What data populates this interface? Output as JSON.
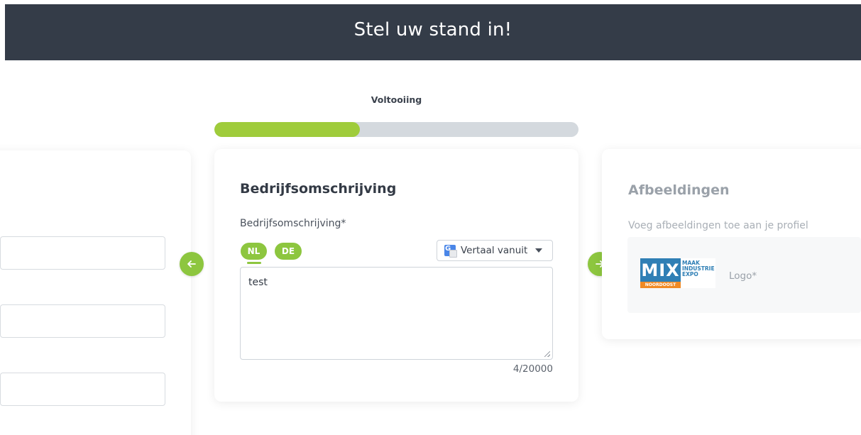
{
  "header": {
    "title": "Stel uw stand in!"
  },
  "progress": {
    "label": "Voltooiing",
    "fraction": 0.4
  },
  "description_card": {
    "title": "Bedrijfsomschrijving",
    "field_label": "Bedrijfsomschrijving*",
    "languages": [
      "NL",
      "DE"
    ],
    "active_language": "NL",
    "translate_label": "Vertaal vanuit",
    "text_value": "test",
    "char_count": "4/20000"
  },
  "images_card": {
    "title": "Afbeeldingen",
    "subtitle": "Voeg afbeeldingen toe aan je profiel",
    "logo_label": "Logo*",
    "logo_text": {
      "letters": "MIX",
      "region": "NOORDOOST",
      "line1": "MAAK",
      "line2": "INDUSTRIE",
      "line3": "EXPO"
    }
  },
  "colors": {
    "header_bg": "#343c48",
    "accent_green": "#8dc63f",
    "progress_fill": "#9fcc3b",
    "progress_track": "#d4d9de"
  },
  "icons": {
    "prev": "arrow-left-icon",
    "next": "arrow-right-icon",
    "translate": "google-translate-icon",
    "dropdown": "caret-down-icon"
  }
}
